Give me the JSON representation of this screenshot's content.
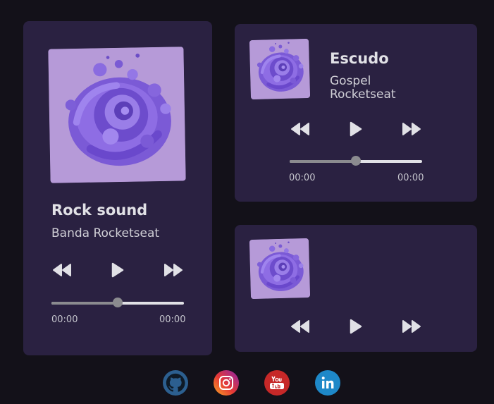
{
  "players": [
    {
      "title": "Rock sound",
      "artist": "Banda Rocketseat",
      "time_current": "00:00",
      "time_total": "00:00",
      "progress": 0.5
    },
    {
      "title": "Escudo",
      "artist": "Gospel Rocketseat",
      "time_current": "00:00",
      "time_total": "00:00",
      "progress": 0.5
    },
    {}
  ],
  "controls": {
    "prev_icon": "rewind-icon",
    "play_icon": "play-icon",
    "next_icon": "fast-forward-icon"
  },
  "social": [
    {
      "icon": "github-icon",
      "color": "#2c5f8f"
    },
    {
      "icon": "instagram-icon",
      "color": "#e1306c"
    },
    {
      "icon": "youtube-icon",
      "color": "#c62828"
    },
    {
      "icon": "linkedin-icon",
      "color": "#1e88c8"
    }
  ],
  "colors": {
    "background": "#131119",
    "card": "#2a2141",
    "text": "#e1e1e6"
  }
}
